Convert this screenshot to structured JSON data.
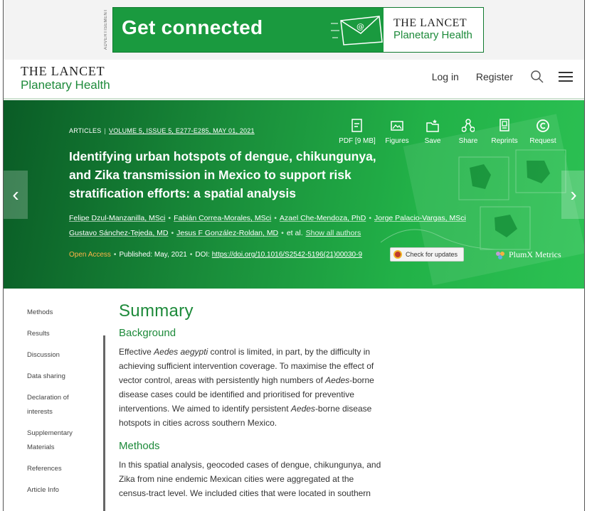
{
  "ad": {
    "label": "ADVERTISEMENT",
    "headline": "Get connected",
    "brand_line1": "THE LANCET",
    "brand_line2": "Planetary Health"
  },
  "header": {
    "logo_line1": "THE LANCET",
    "logo_line2": "Planetary Health",
    "login": "Log in",
    "register": "Register"
  },
  "article": {
    "type": "ARTICLES",
    "volume": "VOLUME 5, ISSUE 5, E277-E285, MAY 01, 2021",
    "title": "Identifying urban hotspots of dengue, chikungunya, and Zika transmission in Mexico to support risk stratification efforts: a spatial analysis",
    "authors": [
      "Felipe Dzul-Manzanilla, MSci",
      "Fabián Correa-Morales, MSci",
      "Azael Che-Mendoza, PhD",
      "Jorge Palacio-Vargas, MSci",
      "Gustavo Sánchez-Tejeda, MD",
      "Jesus F González-Roldan, MD"
    ],
    "et_al": "et al.",
    "show_all": "Show all authors",
    "open_access": "Open Access",
    "published": "Published: May, 2021",
    "doi_label": "DOI:",
    "doi": "https://doi.org/10.1016/S2542-5196(21)00030-9",
    "check_updates": "Check for updates",
    "plumx": "PlumX Metrics"
  },
  "tools": {
    "pdf": "PDF [9 MB]",
    "figures": "Figures",
    "save": "Save",
    "share": "Share",
    "reprints": "Reprints",
    "request": "Request"
  },
  "sidenav": {
    "methods": "Methods",
    "results": "Results",
    "discussion": "Discussion",
    "data_sharing": "Data sharing",
    "declaration1": "Declaration of",
    "declaration2": "interests",
    "supplementary1": "Supplementary",
    "supplementary2": "Materials",
    "references": "References",
    "article_info": "Article Info"
  },
  "summary": {
    "heading": "Summary",
    "background_heading": "Background",
    "background_p1": "Effective ",
    "background_em1": "Aedes aegypti",
    "background_p2": " control is limited, in part, by the difficulty in achieving sufficient intervention coverage. To maximise the effect of vector control, areas with persistently high numbers of ",
    "background_em2": "Aedes",
    "background_p3": "-borne disease cases could be identified and prioritised for preventive interventions. We aimed to identify persistent ",
    "background_em3": "Aedes",
    "background_p4": "-borne disease hotspots in cities across southern Mexico.",
    "methods_heading": "Methods",
    "methods_text": "In this spatial analysis, geocoded cases of dengue, chikungunya, and Zika from nine endemic Mexican cities were aggregated at the census-tract level. We included cities that were located in southern"
  },
  "colors": {
    "brand_green": "#1d8a3a",
    "hero_dark": "#0a5c26",
    "hero_light": "#2cc153",
    "open_access": "#ffb347"
  }
}
